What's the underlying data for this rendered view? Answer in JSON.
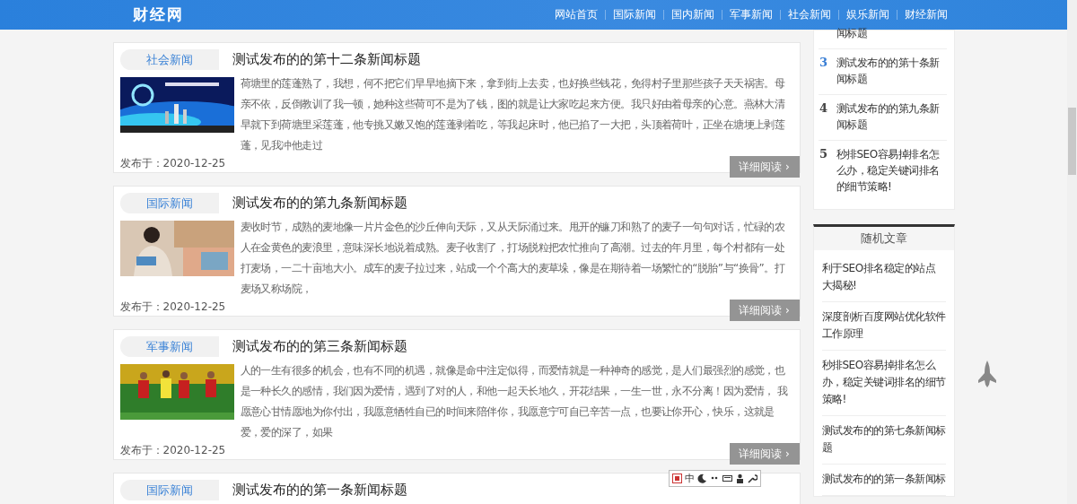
{
  "header": {
    "logo": "财经网",
    "nav": [
      {
        "label": "网站首页"
      },
      {
        "label": "国际新闻"
      },
      {
        "label": "国内新闻"
      },
      {
        "label": "军事新闻"
      },
      {
        "label": "社会新闻"
      },
      {
        "label": "娱乐新闻"
      },
      {
        "label": "财经新闻"
      }
    ]
  },
  "articles": [
    {
      "category": "社会新闻",
      "title": "测试发布的的第十二条新闻标题",
      "summary": "荷塘里的莲蓬熟了，我想，何不把它们早早地摘下来，拿到街上去卖，也好换些钱花，免得村子里那些孩子天天祸害。母亲不依，反倒教训了我一顿，她种这些荷可不是为了钱，图的就是让大家吃起来方便。我只好由着母亲的心意。燕林大清早就下到荷塘里采莲蓬，他专挑又嫩又饱的莲蓬剥着吃，等我起床时，他已掐了一大把，头顶着荷叶，正坐在塘埂上剥莲蓬，见我冲他走过",
      "date": "发布于：2020-12-25",
      "more": "详细阅读",
      "more_icon": "›"
    },
    {
      "category": "国际新闻",
      "title": "测试发布的的第九条新闻标题",
      "summary": "麦收时节，成熟的麦地像一片片金色的沙丘伸向天际，又从天际涌过来。甩开的镰刀和熟了的麦子一句句对话，忙碌的农人在金黄色的麦浪里，意味深长地说着成熟。麦子收割了，打场脱粒把农忙推向了高潮。过去的年月里，每个村都有一处打麦场，一二十亩地大小。成车的麦子拉过来，站成一个个高大的麦草垛，像是在期待着一场繁忙的“脱胎”与“换骨”。打麦场又称场院，",
      "date": "发布于：2020-12-25",
      "more": "详细阅读",
      "more_icon": "›"
    },
    {
      "category": "军事新闻",
      "title": "测试发布的的第三条新闻标题",
      "summary": "人的一生有很多的机会，也有不同的机遇，就像是命中注定似得，而爱情就是一种神奇的感觉，是人们最强烈的感觉，也是一种长久的感情，我们因为爱情，遇到了对的人，和他一起天长地久，开花结果，一生一世，永不分离！因为爱情， 我愿意心甘情愿地为你付出，我愿意牺牲自已的时间来陪伴你，我愿意宁可自已辛苦一点，也要让你开心，快乐，这就是爱，爱的深了，如果",
      "date": "发布于：2020-12-25",
      "more": "详细阅读",
      "more_icon": "›"
    },
    {
      "category": "国际新闻",
      "title": "测试发布的的第一条新闻标题"
    }
  ],
  "sidebar": {
    "hot_list": [
      {
        "title": "闻标题"
      },
      {
        "rank": "3",
        "color": "#3a7fd5",
        "title": "测试发布的的第十条新闻标题"
      },
      {
        "rank": "4",
        "color": "#444444",
        "title": "测试发布的的第九条新闻标题"
      },
      {
        "rank": "5",
        "color": "#444444",
        "title": "秒排SEO容易掉排名怎么办，稳定关键词排名的细节策略!"
      }
    ],
    "random": {
      "title": "随机文章",
      "items": [
        {
          "title": "利于SEO排名稳定的站点大揭秘!"
        },
        {
          "title": "深度剖析百度网站优化软件工作原理"
        },
        {
          "title": "秒排SEO容易掉排名怎么办，稳定关键词排名的细节策略!"
        },
        {
          "title": "测试发布的的第七条新闻标题"
        },
        {
          "title": "测试发布的的第一条新闻标"
        }
      ]
    }
  },
  "ime_toolbar": {
    "mode": "中"
  }
}
